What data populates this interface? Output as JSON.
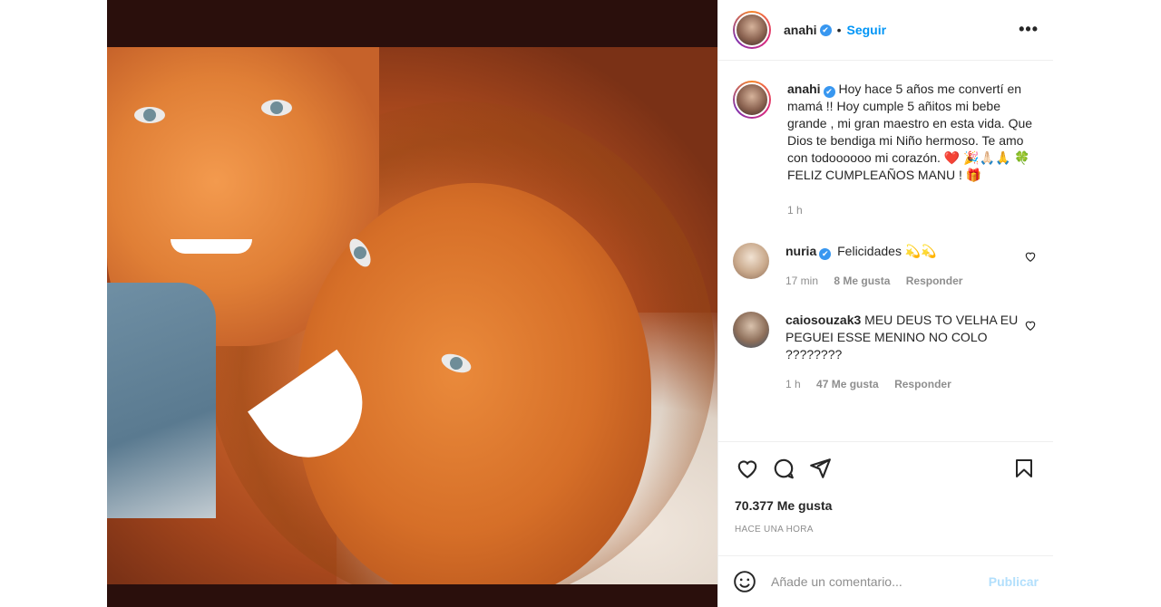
{
  "post": {
    "username": "anahi",
    "verified_icon": "✔",
    "separator": "•",
    "follow_label": "Seguir",
    "more_label": "•••"
  },
  "caption": {
    "username": "anahi",
    "text": "Hoy hace 5 años me convertí en mamá !! Hoy cumple 5 añitos mi bebe grande , mi gran maestro en esta vida. Que Dios te bendiga mi Niño hermoso. Te amo con todoooooo mi corazón. ❤️ 🎉🙏🏻🙏 🍀 FELIZ CUMPLEAÑOS MANU ! 🎁",
    "time": "1 h"
  },
  "comments": [
    {
      "username": "nuria",
      "verified": true,
      "text": "Felicidades 💫💫",
      "time": "17 min",
      "likes": "8 Me gusta",
      "reply": "Responder"
    },
    {
      "username": "caiosouzak3",
      "verified": false,
      "text": "MEU DEUS TO VELHA EU PEGUEI ESSE MENINO NO COLO ????????",
      "time": "1 h",
      "likes": "47 Me gusta",
      "reply": "Responder"
    }
  ],
  "likes_count": "70.377 Me gusta",
  "posted_ago": "HACE UNA HORA",
  "add_comment": {
    "placeholder": "Añade un comentario...",
    "publish_label": "Publicar"
  },
  "icons": [
    "heart-icon",
    "comment-icon",
    "share-icon",
    "bookmark-icon",
    "emoji-icon",
    "more-icon",
    "verified-icon"
  ],
  "colors": {
    "accent": "#0095f6",
    "verified": "#3897f0",
    "publish_disabled": "#b2dffc",
    "muted": "#8e8e8e"
  }
}
